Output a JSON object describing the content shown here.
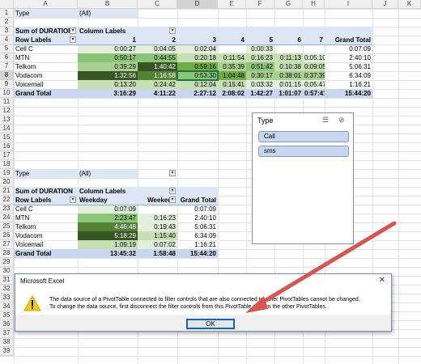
{
  "columns": [
    "A",
    "B",
    "C",
    "D",
    "E",
    "F",
    "G",
    "H",
    "I",
    "J",
    "K"
  ],
  "rows": [
    "1",
    "2",
    "3",
    "4",
    "5",
    "6",
    "7",
    "8",
    "9",
    "10",
    "11",
    "12",
    "13",
    "14",
    "15",
    "16",
    "17",
    "18",
    "19",
    "20",
    "21",
    "22",
    "23",
    "24",
    "25",
    "26",
    "27",
    "28",
    "29",
    "30",
    "31",
    "32",
    "33",
    "34",
    "35",
    "36",
    "37",
    "38",
    "39"
  ],
  "pivot1": {
    "filter_label": "Type",
    "filter_value": "(All)",
    "values_label": "Sum of DURATION",
    "column_labels": "Column Labels",
    "row_labels": "Row Labels",
    "col_headers": [
      "1",
      "2",
      "3",
      "4",
      "5",
      "6",
      "7",
      "Grand Total"
    ],
    "rows": [
      {
        "label": "Cell C",
        "cells": [
          "0:00:27",
          "0:04:05",
          "0:02:04",
          "",
          "0:00:33",
          "",
          "",
          "0:07:09"
        ]
      },
      {
        "label": "MTN",
        "cells": [
          "0:50:17",
          "0:44:55",
          "0:20:18",
          "0:11:54",
          "0:16:23",
          "0:11:13",
          "0:05:10",
          "2:40:10"
        ]
      },
      {
        "label": "Telkom",
        "cells": [
          "0:39:29",
          "1:40:42",
          "0:59:16",
          "0:35:39",
          "0:51:42",
          "0:10:38",
          "0:09:05",
          "5:06:31"
        ]
      },
      {
        "label": "Vodacom",
        "cells": [
          "1:32:56",
          "1:16:58",
          "0:53:30",
          "1:04:48",
          "0:30:17",
          "0:38:01",
          "0:37:39",
          "6:34:09"
        ]
      },
      {
        "label": "Voicemail",
        "cells": [
          "0:13:20",
          "0:24:42",
          "0:12:04",
          "0:15:41",
          "0:03:32",
          "0:01:15",
          "0:05:47",
          "1:16:21"
        ]
      }
    ],
    "grand_total_label": "Grand Total",
    "grand_totals": [
      "3:16:29",
      "4:11:22",
      "2:27:12",
      "2:08:02",
      "1:42:27",
      "1:01:07",
      "0:57:41",
      "15:44:20"
    ]
  },
  "pivot2": {
    "filter_label": "Type",
    "filter_value": "(All)",
    "values_label": "Sum of DURATION",
    "column_labels": "Column Labels",
    "row_labels": "Row Labels",
    "col_headers": [
      "Weekday",
      "Weekend",
      "Grand Total"
    ],
    "rows": [
      {
        "label": "Cell C",
        "cells": [
          "0:07:09",
          "",
          "0:07:09"
        ]
      },
      {
        "label": "MTN",
        "cells": [
          "2:23:47",
          "0:16:23",
          "2:40:10"
        ]
      },
      {
        "label": "Telkom",
        "cells": [
          "4:46:48",
          "0:19:43",
          "5:06:31"
        ]
      },
      {
        "label": "Vodacom",
        "cells": [
          "5:18:29",
          "1:15:40",
          "6:34:09"
        ]
      },
      {
        "label": "Voicemail",
        "cells": [
          "1:09:19",
          "0:07:02",
          "1:16:21"
        ]
      }
    ],
    "grand_total_label": "Grand Total",
    "grand_totals": [
      "13:45:32",
      "1:58:48",
      "15:44:20"
    ]
  },
  "colors": {
    "accent": "#217346",
    "heat": [
      "#e2efda",
      "#c6e0b4",
      "#a9d08e",
      "#8cc47a",
      "#70ad47",
      "#548235",
      "#375623"
    ],
    "dialog_border": "#6f8fc8",
    "arrow": "#d9534f"
  },
  "slicer": {
    "title": "Type",
    "multi_select_icon": "multi-select-icon",
    "clear_filter_icon": "clear-filter-icon",
    "items": [
      "Call",
      "sms"
    ]
  },
  "dialog": {
    "title": "Microsoft Excel",
    "close_glyph": "✕",
    "icon": "warning-icon",
    "message_line1": "The data source of a PivotTable connected to filter controls that are also connected to other PivotTables cannot be changed.",
    "message_line2": "To change the data source, first disconnect the filter controls from this PivotTable or from the other PivotTables.",
    "ok_label": "OK"
  }
}
